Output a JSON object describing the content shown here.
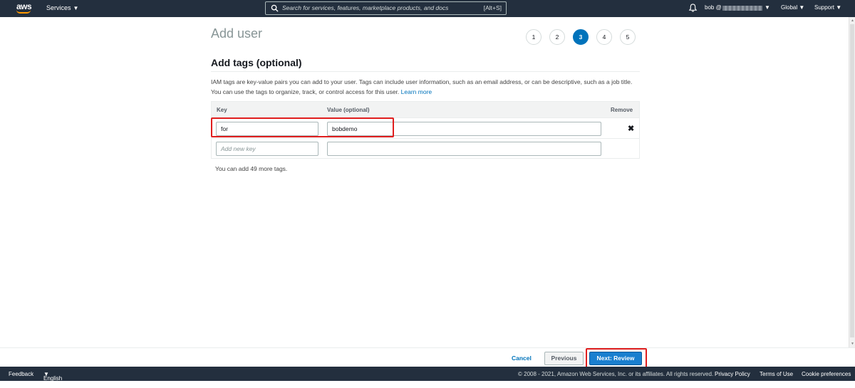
{
  "topnav": {
    "logo_text": "aws",
    "services_label": "Services",
    "search_placeholder": "Search for services, features, marketplace products, and docs",
    "search_shortcut": "[Alt+S]",
    "account_label": "bob @",
    "region_label": "Global",
    "support_label": "Support",
    "icons": [
      "search-icon",
      "bell-icon",
      "caret-down-icon"
    ]
  },
  "page": {
    "title": "Add user",
    "steps": [
      {
        "label": "1",
        "active": false
      },
      {
        "label": "2",
        "active": false
      },
      {
        "label": "3",
        "active": true
      },
      {
        "label": "4",
        "active": false
      },
      {
        "label": "5",
        "active": false
      }
    ],
    "accent_color": "#0073bb"
  },
  "tags": {
    "section_title": "Add tags (optional)",
    "description": "IAM tags are key-value pairs you can add to your user. Tags can include user information, such as an email address, or can be descriptive, such as a job title. You can use the tags to organize, track, or control access for this user.",
    "learn_more": "Learn more",
    "columns": {
      "key": "Key",
      "value": "Value (optional)",
      "remove": "Remove"
    },
    "rows": [
      {
        "key": "for",
        "value": "bobdemo",
        "remove_icon": "✖"
      }
    ],
    "new_key_placeholder": "Add new key",
    "new_value_placeholder": "",
    "remaining": "You can add 49 more tags."
  },
  "actions": {
    "cancel": "Cancel",
    "previous": "Previous",
    "next": "Next: Review",
    "highlight_color": "#e01e1e"
  },
  "footer": {
    "feedback": "Feedback",
    "language": "English (US)",
    "copyright": "© 2008 - 2021, Amazon Web Services, Inc. or its affiliates. All rights reserved.",
    "privacy": "Privacy Policy",
    "terms": "Terms of Use",
    "cookies": "Cookie preferences"
  }
}
